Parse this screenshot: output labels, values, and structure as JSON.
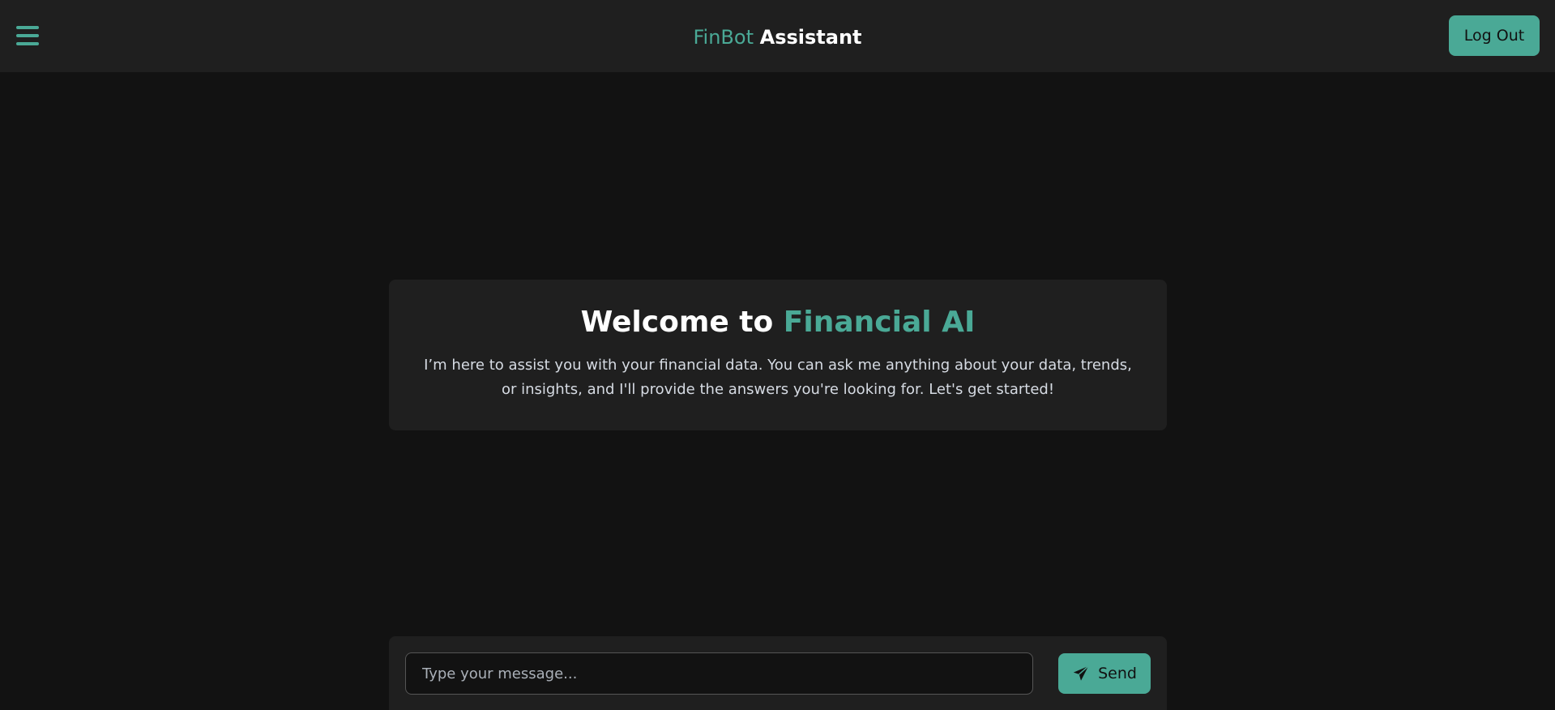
{
  "colors": {
    "accent": "#4aa996",
    "background": "#121212",
    "panel": "#1f1f1f"
  },
  "header": {
    "menu_icon": "hamburger-menu-icon",
    "brand_accent": "FinBot",
    "brand_rest": "Assistant",
    "logout_label": "Log Out"
  },
  "welcome": {
    "title_prefix": "Welcome to",
    "title_accent": "Financial AI",
    "body": "I’m here to assist you with your financial data. You can ask me anything about your data, trends, or insights, and I'll provide the answers you're looking for. Let's get started!"
  },
  "composer": {
    "placeholder": "Type your message...",
    "value": "",
    "send_icon": "paper-plane-icon",
    "send_label": "Send"
  }
}
